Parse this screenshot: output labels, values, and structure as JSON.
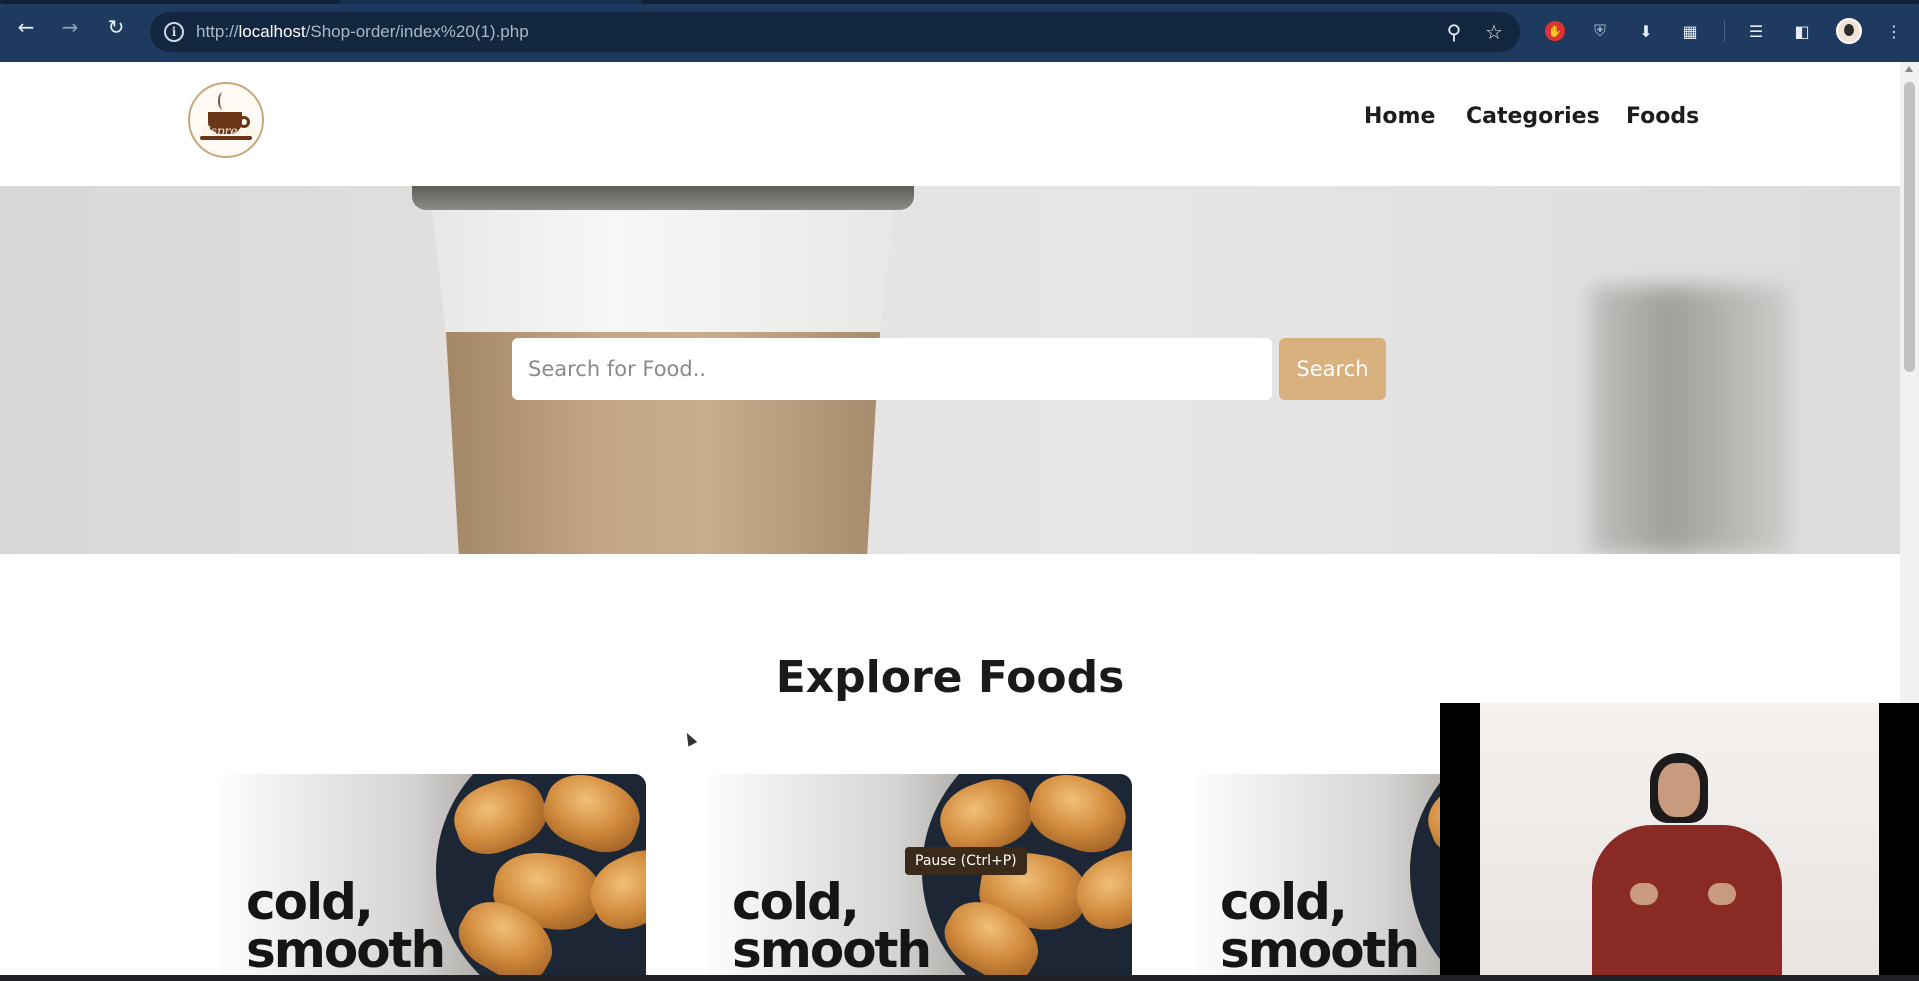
{
  "browser": {
    "url_scheme": "http://",
    "url_host": "localhost",
    "url_path": "/Shop-order/index%20(1).php",
    "nav": [
      "back-icon",
      "forward-icon",
      "reload-icon"
    ],
    "toolbar_icons": [
      "zoom-icon",
      "bookmark-star-icon",
      "adblock-icon",
      "shield-extension-icon",
      "download-extension-icon",
      "extensions-puzzle-icon",
      "media-playlist-icon",
      "side-panel-icon",
      "profile-avatar",
      "menu-dots-icon"
    ]
  },
  "header": {
    "logo_text": "Espresso",
    "menu": [
      "Home",
      "Categories",
      "Foods"
    ]
  },
  "hero": {
    "search_placeholder": "Search for Food..",
    "search_button": "Search"
  },
  "section": {
    "title": "Explore Foods"
  },
  "cards": [
    {
      "text_line1": "cold,",
      "text_line2": "smooth"
    },
    {
      "text_line1": "cold,",
      "text_line2": "smooth"
    },
    {
      "text_line1": "cold,",
      "text_line2": "smooth"
    }
  ],
  "overlay": {
    "tooltip": "Pause (Ctrl+P)"
  },
  "colors": {
    "accent": "#d8b17f",
    "browser_chrome": "#1f3a5f",
    "text_dark": "#1a1a1a"
  }
}
